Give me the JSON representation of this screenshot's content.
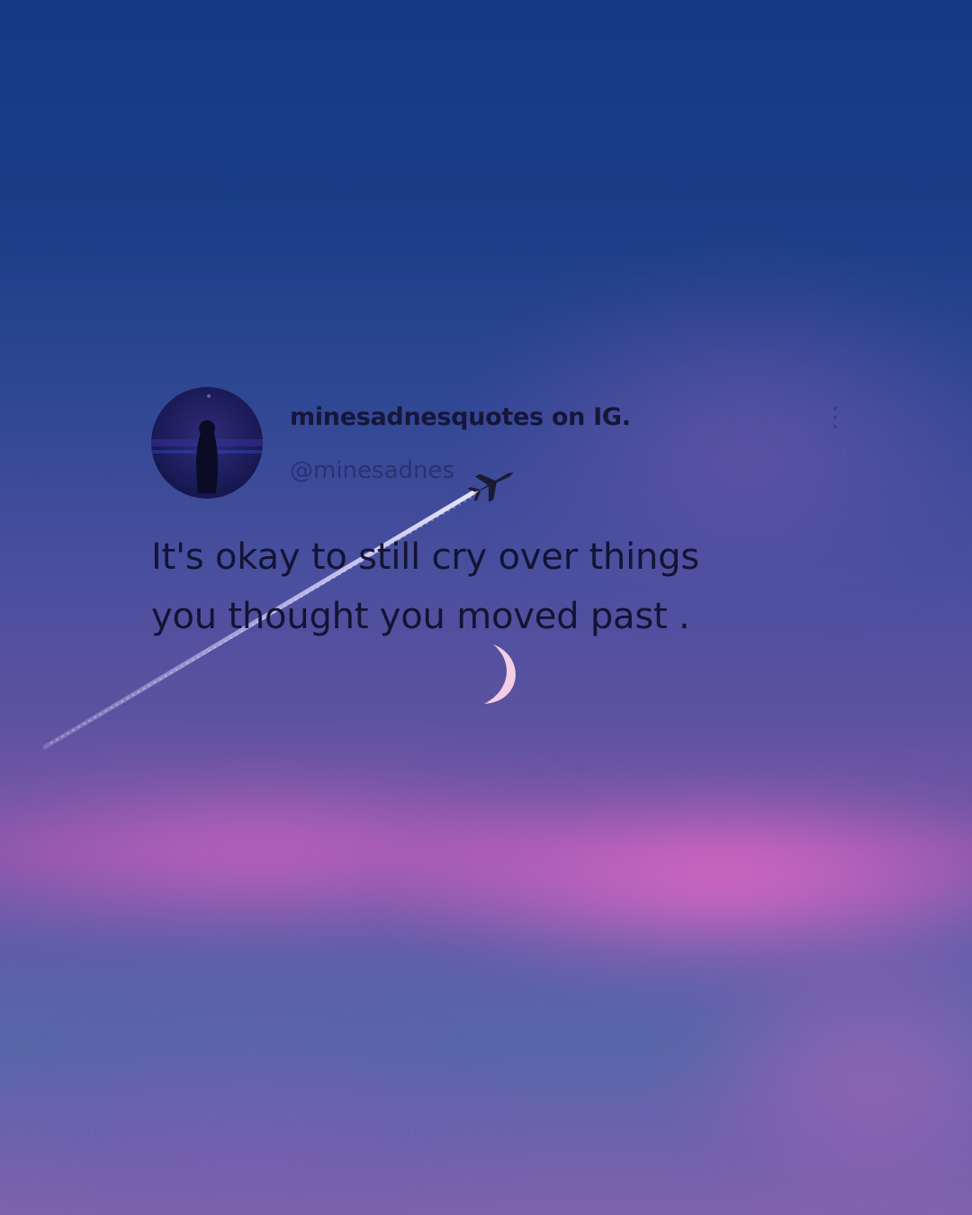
{
  "post": {
    "display_name": "minesadnesquotes on IG.",
    "handle": "@minesadnes",
    "quote_lines": [
      "It's okay to still cry over things",
      "you thought you moved past ."
    ]
  },
  "icons": {
    "avatar": "avatar-silhouette",
    "menu": "more-options-icon",
    "plane": "airplane-icon",
    "moon": "crescent-moon-icon"
  },
  "colors": {
    "sky_top": "#143a83",
    "sky_mid": "#5b529f",
    "cloud_pink": "#f06ac8",
    "text": "#131433"
  }
}
